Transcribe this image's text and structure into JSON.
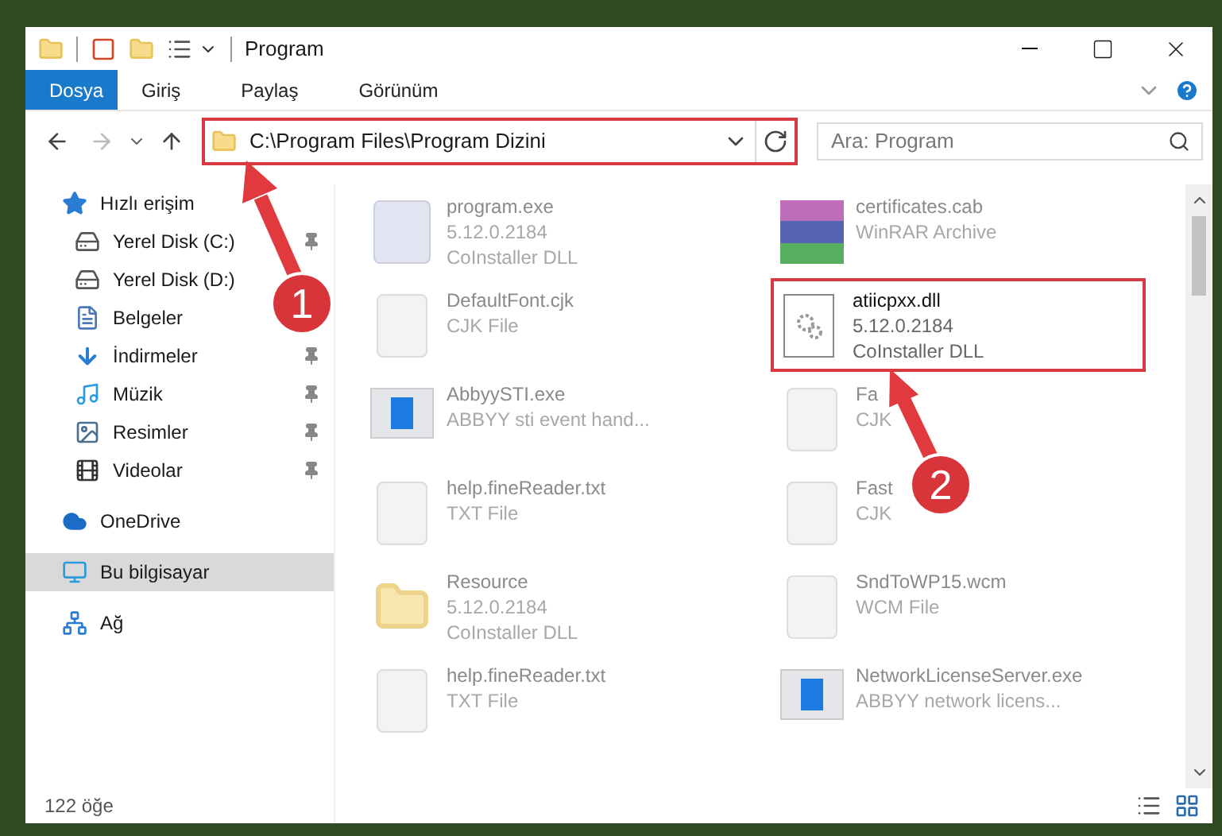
{
  "window": {
    "title": "Program"
  },
  "ribbon_tabs": [
    {
      "label": "Dosya",
      "selected": true
    },
    {
      "label": "Giriş",
      "selected": false
    },
    {
      "label": "Paylaş",
      "selected": false
    },
    {
      "label": "Görünüm",
      "selected": false
    }
  ],
  "address_bar": {
    "path": "C:\\Program Files\\Program Dizini",
    "highlighted": true
  },
  "search": {
    "placeholder": "Ara: Program"
  },
  "sidebar": {
    "items": [
      {
        "label": "Hızlı erişim",
        "kind": "quick",
        "selected": false,
        "children": [
          {
            "label": "Yerel Disk (C:)",
            "kind": "drive-c",
            "pinned": true
          },
          {
            "label": "Yerel Disk (D:)",
            "kind": "drive",
            "pinned": false
          },
          {
            "label": "Belgeler",
            "kind": "documents",
            "pinned": false
          },
          {
            "label": "İndirmeler",
            "kind": "downloads",
            "pinned": true
          },
          {
            "label": "Müzik",
            "kind": "music",
            "pinned": true
          },
          {
            "label": "Resimler",
            "kind": "pictures",
            "pinned": true
          },
          {
            "label": "Videolar",
            "kind": "videos",
            "pinned": true
          }
        ]
      },
      {
        "label": "OneDrive",
        "kind": "cloud",
        "selected": false
      },
      {
        "label": "Bu bilgisayar",
        "kind": "computer",
        "selected": true
      },
      {
        "label": "Ağ",
        "kind": "network",
        "selected": false
      }
    ]
  },
  "files": [
    {
      "name": "program.exe",
      "kind": "installer",
      "details": [
        "5.12.0.2184",
        "CoInstaller DLL"
      ],
      "highlighted": false
    },
    {
      "name": "certificates.cab",
      "kind": "archive",
      "details": [
        "WinRAR Archive"
      ],
      "highlighted": false
    },
    {
      "name": "DefaultFont.cjk",
      "kind": "blank",
      "details": [
        "CJK File"
      ],
      "highlighted": false
    },
    {
      "name": "atiicpxx.dll",
      "kind": "dll",
      "details": [
        "5.12.0.2184",
        "CoInstaller DLL"
      ],
      "highlighted": true
    },
    {
      "name": "AbbyySTI.exe",
      "kind": "app",
      "details": [
        "ABBYY sti event hand..."
      ],
      "highlighted": false
    },
    {
      "name": "Fa",
      "kind": "blank",
      "details": [
        "CJK"
      ],
      "highlighted": false
    },
    {
      "name": "help.fineReader.txt",
      "kind": "blank",
      "details": [
        "TXT File"
      ],
      "highlighted": false
    },
    {
      "name": "Fast",
      "kind": "blank",
      "details": [
        "CJK"
      ],
      "highlighted": false
    },
    {
      "name": "Resource",
      "kind": "folder",
      "details": [
        "5.12.0.2184",
        "CoInstaller DLL"
      ],
      "highlighted": false
    },
    {
      "name": "SndToWP15.wcm",
      "kind": "blank",
      "details": [
        "WCM File"
      ],
      "highlighted": false
    },
    {
      "name": "help.fineReader.txt",
      "kind": "blank",
      "details": [
        "TXT File"
      ],
      "highlighted": false
    },
    {
      "name": "NetworkLicenseServer.exe",
      "kind": "app",
      "details": [
        "ABBYY network licens..."
      ],
      "highlighted": false
    }
  ],
  "status_bar": {
    "item_count": "122 öğe"
  },
  "annotations": [
    {
      "label": "1"
    },
    {
      "label": "2"
    }
  ]
}
